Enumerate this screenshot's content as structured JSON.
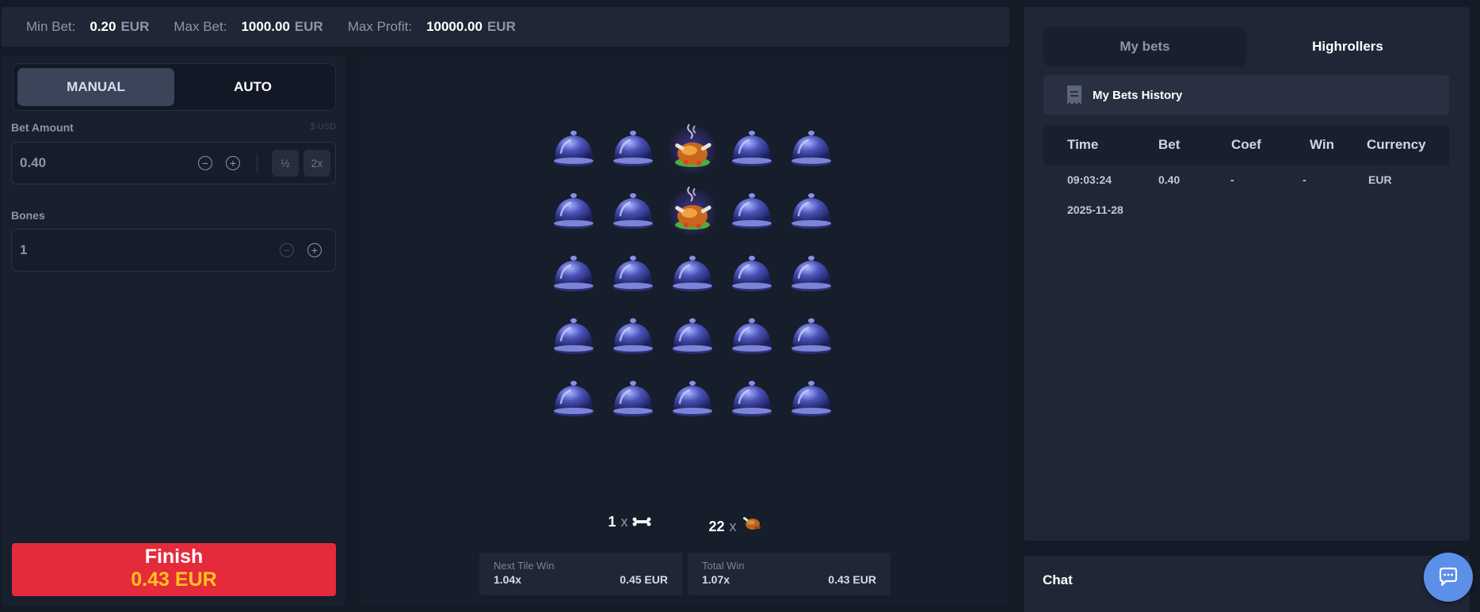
{
  "limits": {
    "min_bet_label": "Min Bet:",
    "min_bet_value": "0.20",
    "min_bet_currency": "EUR",
    "max_bet_label": "Max Bet:",
    "max_bet_value": "1000.00",
    "max_bet_currency": "EUR",
    "max_profit_label": "Max Profit:",
    "max_profit_value": "10000.00",
    "max_profit_currency": "EUR"
  },
  "mode": {
    "manual": "MANUAL",
    "auto": "AUTO",
    "active": "manual"
  },
  "bet": {
    "label": "Bet Amount",
    "usd_hint": "$ USD",
    "value": "0.40",
    "half": "½",
    "double": "2x"
  },
  "bones": {
    "label": "Bones",
    "value": "1"
  },
  "finish": {
    "label": "Finish",
    "amount": "0.43",
    "currency": "EUR"
  },
  "board": {
    "tiles": [
      "cloche",
      "cloche",
      "turkey",
      "cloche",
      "cloche",
      "cloche",
      "cloche",
      "turkey",
      "cloche",
      "cloche",
      "cloche",
      "cloche",
      "cloche",
      "cloche",
      "cloche",
      "cloche",
      "cloche",
      "cloche",
      "cloche",
      "cloche",
      "cloche",
      "cloche",
      "cloche",
      "cloche",
      "cloche"
    ],
    "bones_count": "1",
    "turkeys_count": "22",
    "times": "x"
  },
  "next_tile": {
    "label": "Next Tile Win",
    "coef": "1.04x",
    "amount": "0.45 EUR"
  },
  "total_win": {
    "label": "Total Win",
    "coef": "1.07x",
    "amount": "0.43 EUR"
  },
  "right": {
    "tabs": [
      "My bets",
      "Highrollers"
    ],
    "history_title": "My Bets History",
    "columns": [
      "Time",
      "Bet",
      "Coef",
      "Win",
      "Currency"
    ],
    "rows": [
      {
        "time": "09:03:24",
        "bet": "0.40",
        "coef": "-",
        "win": "-",
        "currency": "EUR",
        "date": "2025-11-28"
      }
    ]
  },
  "chat": {
    "title": "Chat"
  },
  "colors": {
    "finish": "#e52a3b",
    "finish_amount": "#ffc21f",
    "chat_button": "#5b8fe8"
  }
}
